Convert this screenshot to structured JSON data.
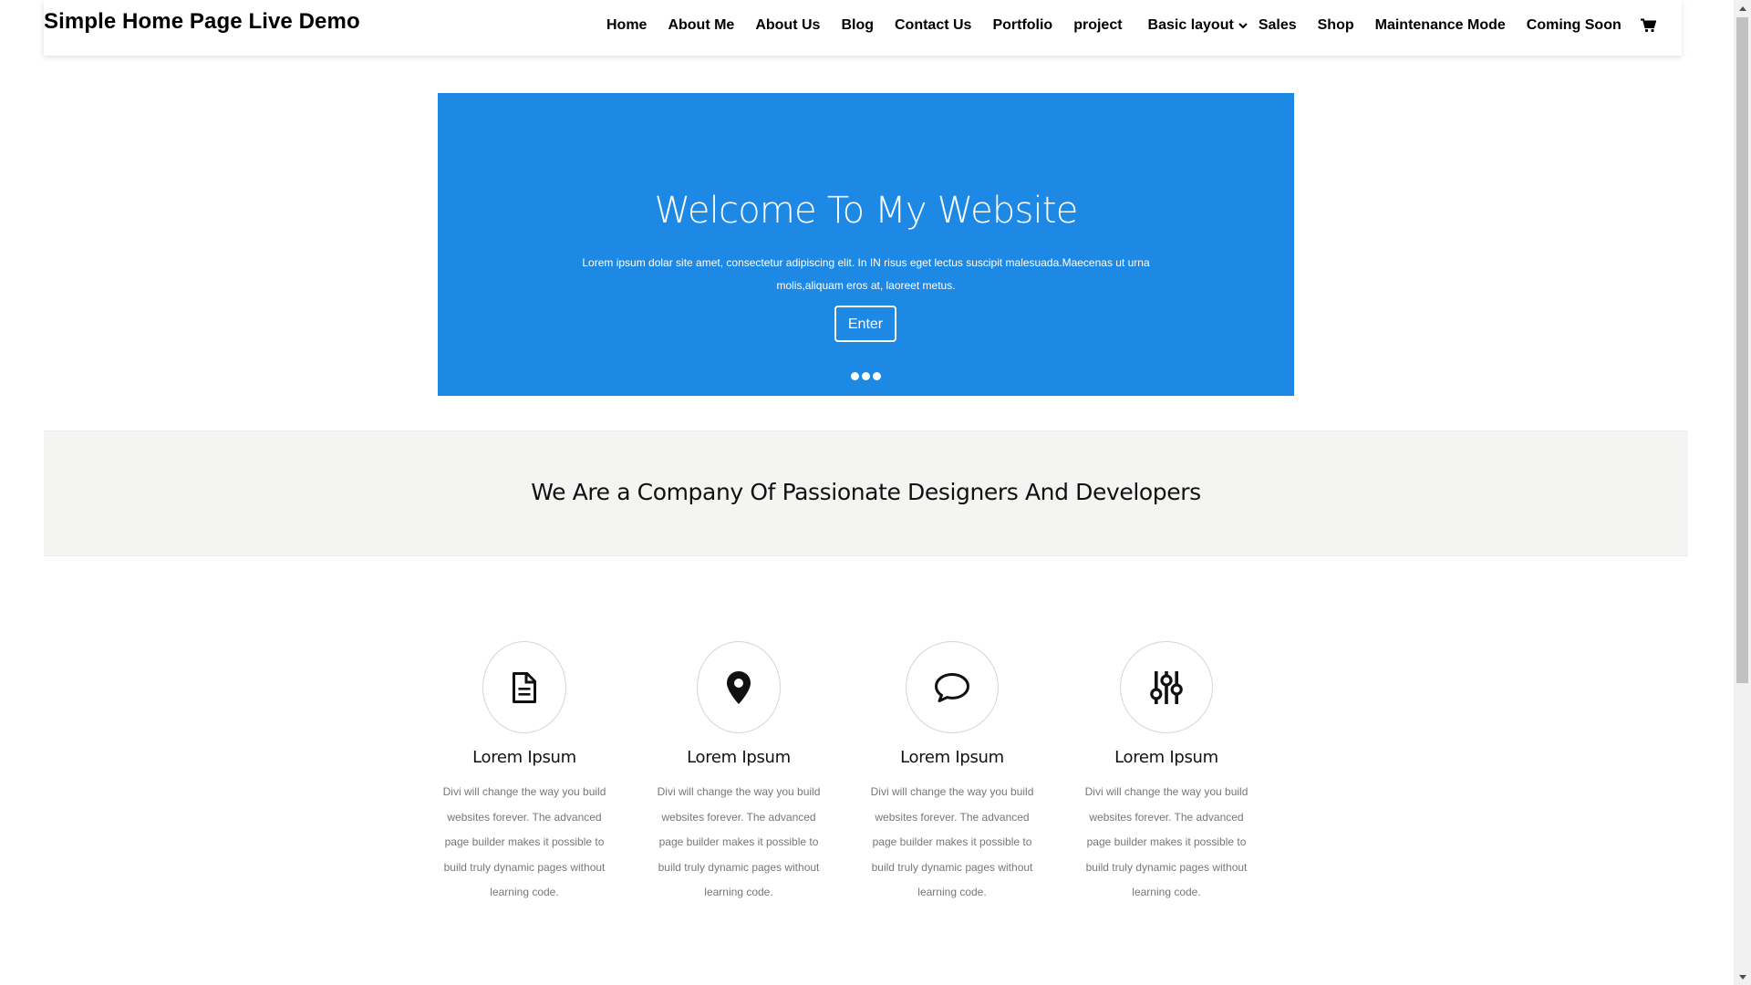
{
  "header": {
    "site_title": "Simple Home Page Live Demo",
    "nav": [
      "Home",
      "About Me",
      "About Us",
      "Blog",
      "Contact Us",
      "Portfolio",
      "project"
    ],
    "dropdown_label": "Basic layout",
    "nav_after": [
      "Sales",
      "Shop",
      "Maintenance Mode",
      "Coming Soon"
    ],
    "cart_icon": "cart-icon"
  },
  "hero": {
    "title": "Welcome To My Website",
    "text": "Lorem ipsum dolar site amet, consectetur adipiscing elit. In IN risus eget lectus suscipit malesuada.Maecenas ut urna molis,aliquam eros at, laoreet metus.",
    "button": "Enter",
    "background": "#1e88e5"
  },
  "band": {
    "title": "We Are a Company Of Passionate Designers And Developers"
  },
  "features": [
    {
      "icon": "document-icon",
      "title": "Lorem Ipsum",
      "text": "Divi will change the way you build websites forever. The advanced page builder makes it possible to build truly dynamic pages without learning code."
    },
    {
      "icon": "map-pin-icon",
      "title": "Lorem Ipsum",
      "text": "Divi will change the way you build websites forever. The advanced page builder makes it possible to build truly dynamic pages without learning code."
    },
    {
      "icon": "chat-bubble-icon",
      "title": "Lorem Ipsum",
      "text": "Divi will change the way you build websites forever. The advanced page builder makes it possible to build truly dynamic pages without learning code."
    },
    {
      "icon": "sliders-icon",
      "title": "Lorem Ipsum",
      "text": "Divi will change the way you build websites forever. The advanced page builder makes it possible to build truly dynamic pages without learning code."
    }
  ]
}
